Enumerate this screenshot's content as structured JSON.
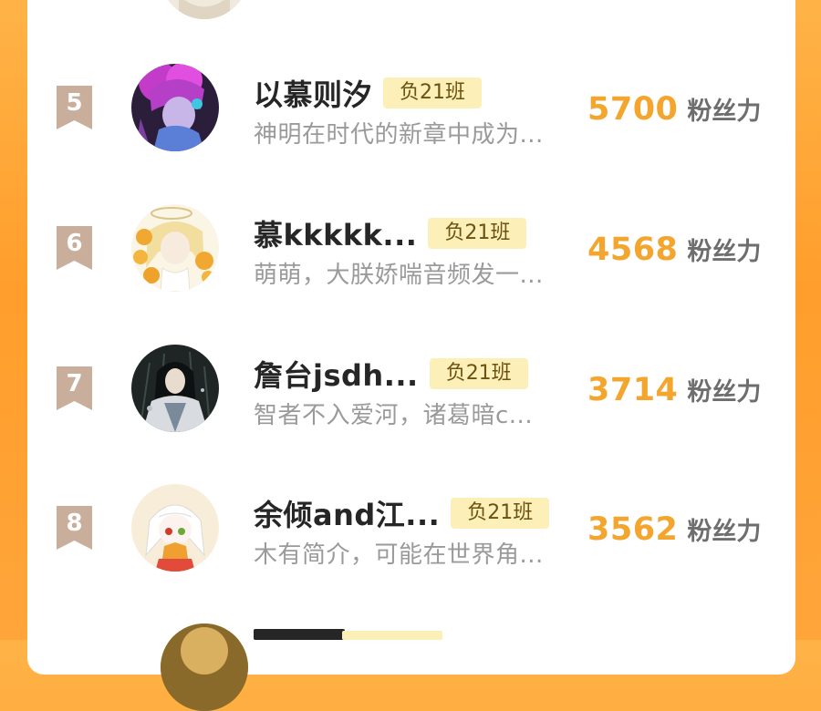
{
  "ranking": {
    "rows": [
      {
        "rank": "5",
        "name": "以慕则汐",
        "tag": "负21班",
        "desc": "神明在时代的新章中成为...",
        "score": "5700",
        "unit": "粉丝力",
        "avatar_icon": "avatar-purple-haired-character-icon"
      },
      {
        "rank": "6",
        "name": "慕kkkkk...",
        "tag": "负21班",
        "desc": "萌萌，大朕娇喘音频发一...",
        "score": "4568",
        "unit": "粉丝力",
        "avatar_icon": "avatar-halo-blonde-character-icon"
      },
      {
        "rank": "7",
        "name": "詹台jsdh...",
        "tag": "负21班",
        "desc": "智者不入爱河，诸葛暗c...",
        "score": "3714",
        "unit": "粉丝力",
        "avatar_icon": "avatar-dark-haired-character-icon"
      },
      {
        "rank": "8",
        "name": "余倾and江...",
        "tag": "负21班",
        "desc": "木有简介，可能在世界角...",
        "score": "3562",
        "unit": "粉丝力",
        "avatar_icon": "avatar-white-haired-character-icon"
      }
    ]
  },
  "colors": {
    "background_orange": "#FF9E2C",
    "score_orange": "#F3A52D",
    "tag_background": "#FCEFB8",
    "rank_badge": "#C9AE9C"
  }
}
